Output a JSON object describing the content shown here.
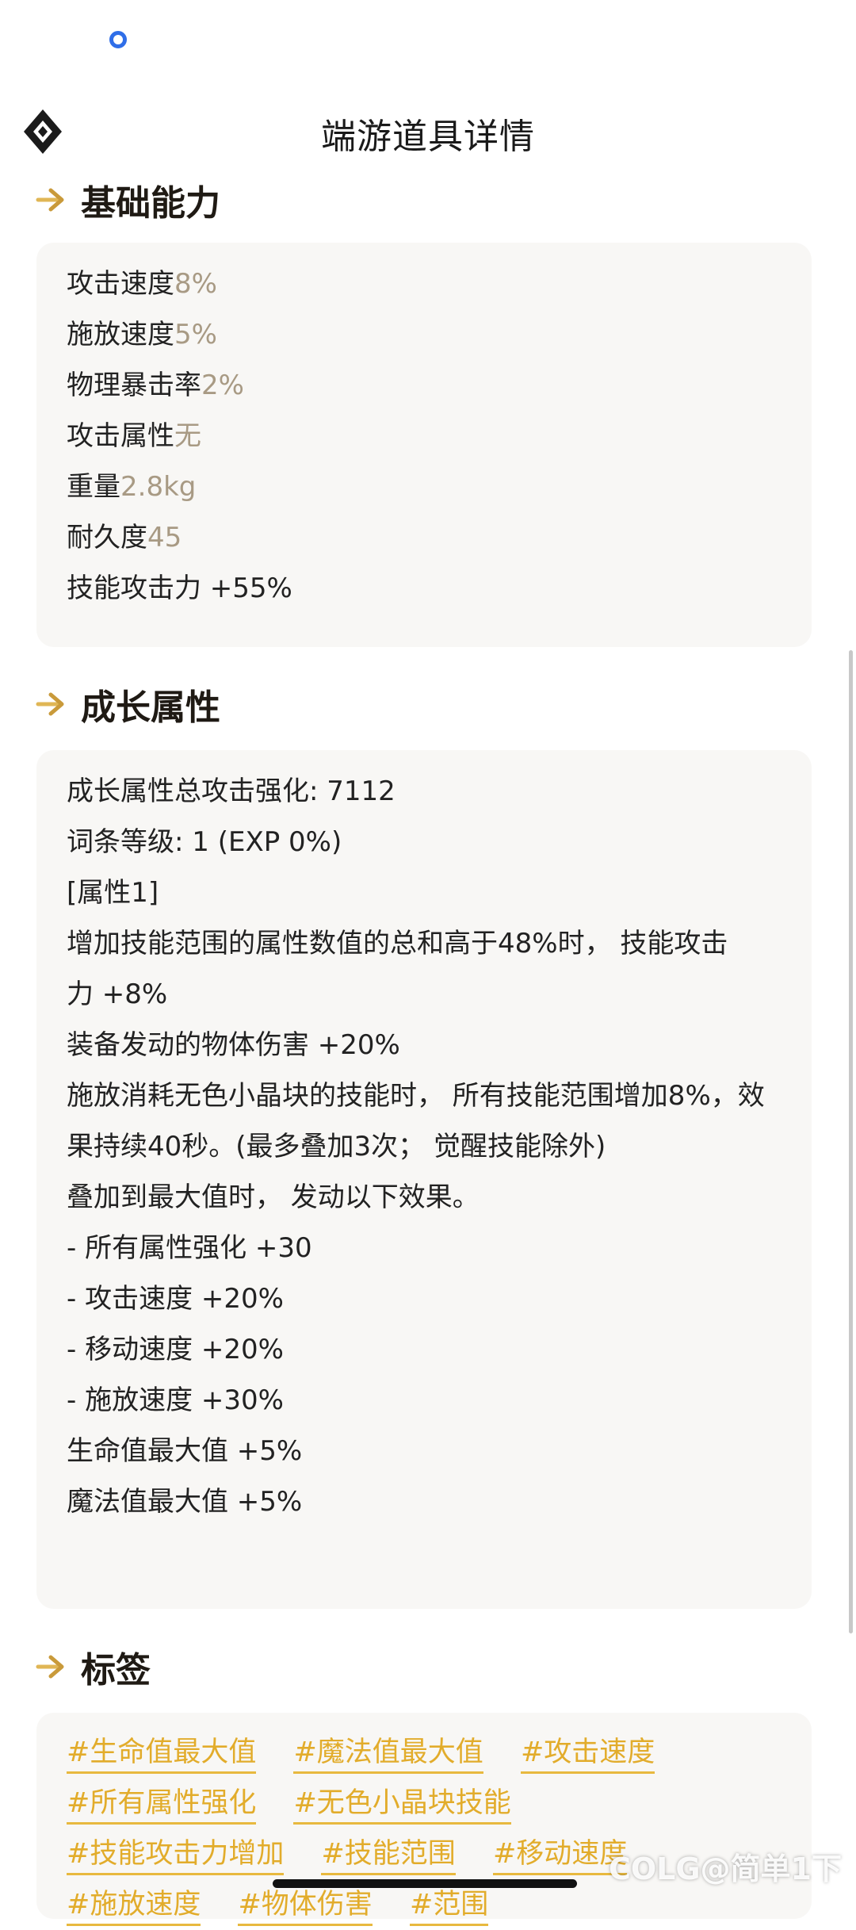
{
  "header": {
    "title": "端游道具详情"
  },
  "basic": {
    "title": "基础能力",
    "stats": [
      {
        "label": "攻击速度",
        "value": "8%"
      },
      {
        "label": "施放速度",
        "value": "5%"
      },
      {
        "label": "物理暴击率",
        "value": "2%"
      },
      {
        "label": "攻击属性",
        "value": "无"
      },
      {
        "label": "重量",
        "value": "2.8kg"
      },
      {
        "label": "耐久度",
        "value": "45"
      }
    ],
    "skill_line": "技能攻击力 +55%"
  },
  "growth": {
    "title": "成长属性",
    "lines": [
      "成长属性总攻击强化: 7112",
      "词条等级: 1 (EXP 0%)",
      "[属性1]",
      "增加技能范围的属性数值的总和高于48%时， 技能攻击力 +8%",
      "装备发动的物体伤害 +20%",
      "施放消耗无色小晶块的技能时， 所有技能范围增加8%，效果持续40秒。(最多叠加3次； 觉醒技能除外)",
      "叠加到最大值时， 发动以下效果。",
      "- 所有属性强化 +30",
      "- 攻击速度 +20%",
      "- 移动速度 +20%",
      "- 施放速度 +30%",
      "生命值最大值 +5%",
      "魔法值最大值 +5%"
    ]
  },
  "tags": {
    "title": "标签",
    "items": [
      "#生命值最大值",
      "#魔法值最大值",
      "#攻击速度",
      "#所有属性强化",
      "#无色小晶块技能",
      "#技能攻击力增加",
      "#技能范围",
      "#移动速度",
      "#施放速度",
      "#物体伤害",
      "#范围"
    ]
  },
  "watermark": "COLG@简单1下",
  "colors": {
    "accent": "#e2ac2b",
    "value": "#a89a84",
    "card_bg": "#f8f7f5"
  }
}
